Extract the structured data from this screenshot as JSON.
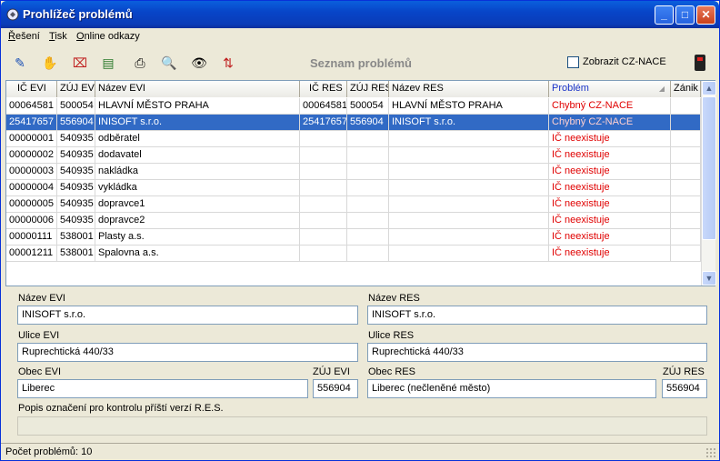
{
  "window": {
    "title": "Prohlížeč problémů",
    "minimize": "_",
    "maximize": "□",
    "close": "✕"
  },
  "menu": [
    {
      "label": "Řešení",
      "key": "Ř",
      "rest": "ešení"
    },
    {
      "label": "Tisk",
      "key": "T",
      "rest": "isk"
    },
    {
      "label": "Online odkazy",
      "key": "O",
      "rest": "nline odkazy"
    }
  ],
  "toolbar": {
    "icons": [
      {
        "name": "edit-icon",
        "glyph": "✎"
      },
      {
        "name": "hand-icon",
        "glyph": "✋"
      },
      {
        "name": "delete-icon",
        "glyph": "⌧"
      },
      {
        "name": "document-icon",
        "glyph": "▤"
      },
      {
        "name": "print-icon",
        "glyph": "⎙"
      },
      {
        "name": "search-icon",
        "glyph": "🔍"
      },
      {
        "name": "view-icon",
        "glyph": "👁"
      },
      {
        "name": "sort-icon",
        "glyph": "⇅"
      }
    ],
    "title": "Seznam problémů",
    "checkbox_label": "Zobrazit CZ-NACE"
  },
  "grid": {
    "columns": [
      "IČ EVI",
      "ZÚJ EVI",
      "Název EVI",
      "IČ RES",
      "ZÚJ RES",
      "Název RES",
      "Problém",
      "Zánik"
    ],
    "rows": [
      {
        "ic_evi": "00064581",
        "zuj_evi": "500054",
        "nazev_evi": "HLAVNÍ MĚSTO PRAHA",
        "ic_res": "00064581",
        "zuj_res": "500054",
        "nazev_res": "HLAVNÍ MĚSTO PRAHA",
        "problem": "Chybný CZ-NACE",
        "zanik": ""
      },
      {
        "ic_evi": "25417657",
        "zuj_evi": "556904",
        "nazev_evi": "INISOFT s.r.o.",
        "ic_res": "25417657",
        "zuj_res": "556904",
        "nazev_res": "INISOFT s.r.o.",
        "problem": "Chybný CZ-NACE",
        "zanik": ""
      },
      {
        "ic_evi": "00000001",
        "zuj_evi": "540935",
        "nazev_evi": "odběratel",
        "ic_res": "",
        "zuj_res": "",
        "nazev_res": "",
        "problem": "IČ neexistuje",
        "zanik": ""
      },
      {
        "ic_evi": "00000002",
        "zuj_evi": "540935",
        "nazev_evi": "dodavatel",
        "ic_res": "",
        "zuj_res": "",
        "nazev_res": "",
        "problem": "IČ neexistuje",
        "zanik": ""
      },
      {
        "ic_evi": "00000003",
        "zuj_evi": "540935",
        "nazev_evi": "nakládka",
        "ic_res": "",
        "zuj_res": "",
        "nazev_res": "",
        "problem": "IČ neexistuje",
        "zanik": ""
      },
      {
        "ic_evi": "00000004",
        "zuj_evi": "540935",
        "nazev_evi": "vykládka",
        "ic_res": "",
        "zuj_res": "",
        "nazev_res": "",
        "problem": "IČ neexistuje",
        "zanik": ""
      },
      {
        "ic_evi": "00000005",
        "zuj_evi": "540935",
        "nazev_evi": "dopravce1",
        "ic_res": "",
        "zuj_res": "",
        "nazev_res": "",
        "problem": "IČ neexistuje",
        "zanik": ""
      },
      {
        "ic_evi": "00000006",
        "zuj_evi": "540935",
        "nazev_evi": "dopravce2",
        "ic_res": "",
        "zuj_res": "",
        "nazev_res": "",
        "problem": "IČ neexistuje",
        "zanik": ""
      },
      {
        "ic_evi": "00000111",
        "zuj_evi": "538001",
        "nazev_evi": "Plasty a.s.",
        "ic_res": "",
        "zuj_res": "",
        "nazev_res": "",
        "problem": "IČ neexistuje",
        "zanik": ""
      },
      {
        "ic_evi": "00001211",
        "zuj_evi": "538001",
        "nazev_evi": "Spalovna a.s.",
        "ic_res": "",
        "zuj_res": "",
        "nazev_res": "",
        "problem": "IČ neexistuje",
        "zanik": ""
      }
    ],
    "selected_row": 1
  },
  "details": {
    "nazev_evi_label": "Název EVI",
    "nazev_evi": "INISOFT s.r.o.",
    "nazev_res_label": "Název RES",
    "nazev_res": "INISOFT s.r.o.",
    "ulice_evi_label": "Ulice EVI",
    "ulice_evi": "Ruprechtická 440/33",
    "ulice_res_label": "Ulice RES",
    "ulice_res": "Ruprechtická 440/33",
    "obec_evi_label": "Obec EVI",
    "obec_evi": "Liberec",
    "zuj_evi_label": "ZÚJ EVI",
    "zuj_evi": "556904",
    "obec_res_label": "Obec RES",
    "obec_res": "Liberec (nečleněné město)",
    "zuj_res_label": "ZÚJ RES",
    "zuj_res": "556904",
    "popis_label": "Popis označení pro kontrolu příští verzí R.E.S.",
    "popis": ""
  },
  "status": {
    "text": "Počet problémů: 10"
  }
}
